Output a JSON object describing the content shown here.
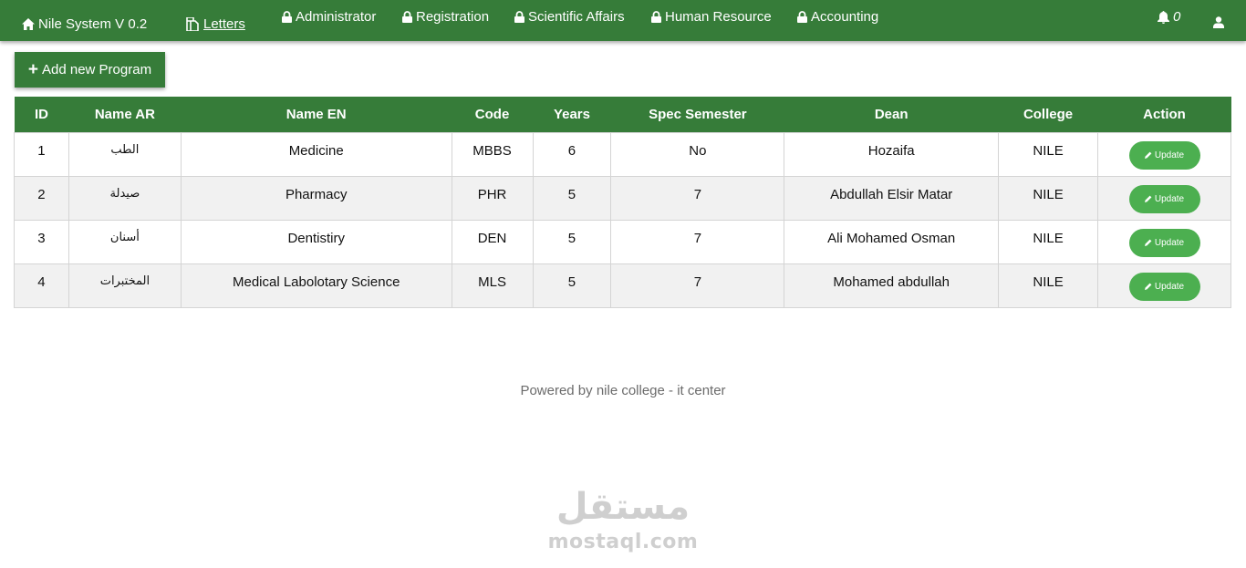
{
  "navbar": {
    "brand": "Nile System V 0.2",
    "letters": "Letters",
    "items": [
      {
        "label": "Administrator"
      },
      {
        "label": "Registration"
      },
      {
        "label": "Scientific Affairs"
      },
      {
        "label": "Human Resource"
      },
      {
        "label": "Accounting"
      }
    ],
    "notifications_count": "0",
    "color": "#367c39"
  },
  "toolbar": {
    "add_label": "Add new Program"
  },
  "table": {
    "headers": [
      "ID",
      "Name AR",
      "Name EN",
      "Code",
      "Years",
      "Spec Semester",
      "Dean",
      "College",
      "Action"
    ],
    "rows": [
      {
        "id": "1",
        "name_ar": "الطب",
        "name_en": "Medicine",
        "code": "MBBS",
        "years": "6",
        "spec": "No",
        "dean": "Hozaifa",
        "college": "NILE",
        "action": "Update"
      },
      {
        "id": "2",
        "name_ar": "صيدلة",
        "name_en": "Pharmacy",
        "code": "PHR",
        "years": "5",
        "spec": "7",
        "dean": "Abdullah Elsir Matar",
        "college": "NILE",
        "action": "Update"
      },
      {
        "id": "3",
        "name_ar": "أسنان",
        "name_en": "Dentistiry",
        "code": "DEN",
        "years": "5",
        "spec": "7",
        "dean": "Ali Mohamed Osman",
        "college": "NILE",
        "action": "Update"
      },
      {
        "id": "4",
        "name_ar": "المختبرات",
        "name_en": "Medical Labolotary Science",
        "code": "MLS",
        "years": "5",
        "spec": "7",
        "dean": "Mohamed abdullah",
        "college": "NILE",
        "action": "Update"
      }
    ]
  },
  "footer": {
    "text": "Powered by nile college - it center"
  },
  "watermark": {
    "arabic": "مستقل",
    "latin": "mostaql.com"
  }
}
